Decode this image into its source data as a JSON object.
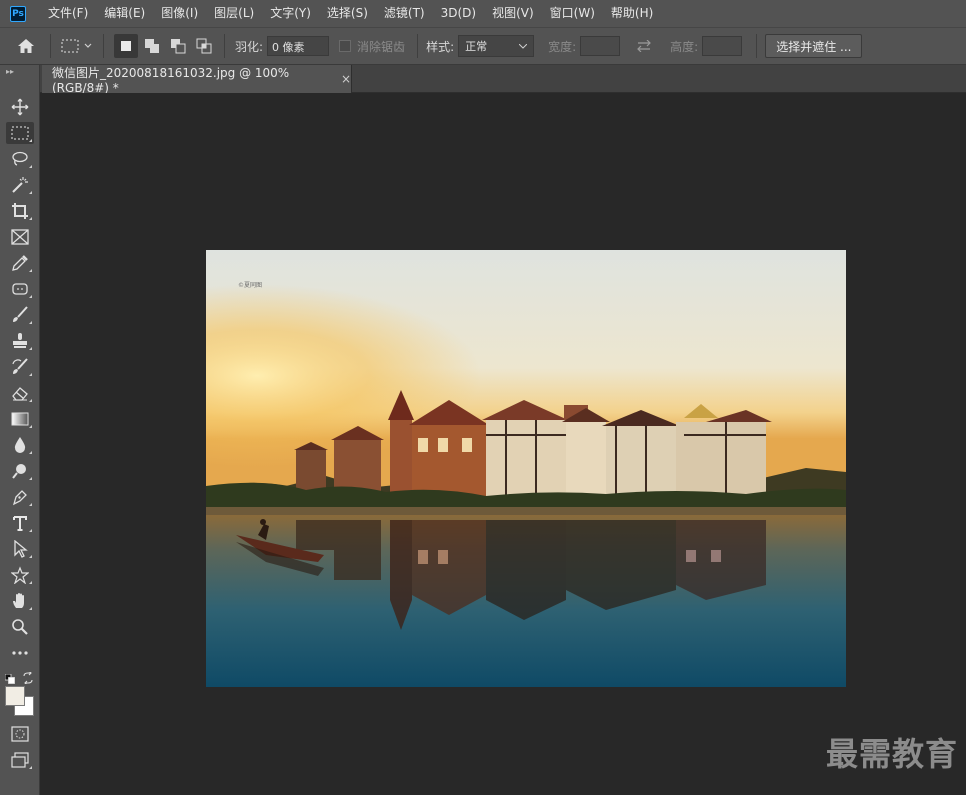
{
  "app": {
    "logo": "Ps"
  },
  "menu": [
    "文件(F)",
    "编辑(E)",
    "图像(I)",
    "图层(L)",
    "文字(Y)",
    "选择(S)",
    "滤镜(T)",
    "3D(D)",
    "视图(V)",
    "窗口(W)",
    "帮助(H)"
  ],
  "options": {
    "feather_label": "羽化:",
    "feather_value": "0 像素",
    "antialias_label": "消除锯齿",
    "style_label": "样式:",
    "style_value": "正常",
    "width_label": "宽度:",
    "height_label": "高度:",
    "select_mask_button": "选择并遮住 ..."
  },
  "document": {
    "tab_title": "微信图片_20200818161032.jpg @ 100%(RGB/8#) *",
    "close_glyph": "×"
  },
  "image": {
    "small_text": "©夏同图"
  },
  "watermark": "最需教育",
  "tools": [
    "move-tool-icon",
    "marquee-tool-icon",
    "lasso-tool-icon",
    "magic-wand-icon",
    "crop-tool-icon",
    "frame-tool-icon",
    "eyedropper-icon",
    "healing-brush-icon",
    "brush-icon",
    "clone-stamp-icon",
    "history-brush-icon",
    "eraser-icon",
    "gradient-icon",
    "blur-icon",
    "dodge-icon",
    "pen-icon",
    "type-icon",
    "path-select-icon",
    "shape-icon",
    "hand-icon",
    "zoom-icon",
    "more-tools-icon"
  ],
  "colors": {
    "foreground": "#f1ede4",
    "background": "#ffffff"
  }
}
